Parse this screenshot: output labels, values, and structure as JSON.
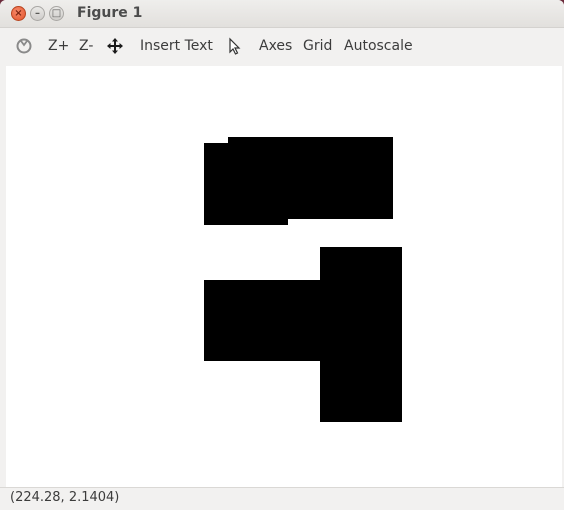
{
  "window": {
    "title": "Figure 1",
    "close_glyph": "×",
    "min_glyph": "–",
    "max_glyph": "□"
  },
  "toolbar": {
    "reset_icon": "reset-zoom-icon",
    "zoom_in_label": "Z+",
    "zoom_out_label": "Z-",
    "pan_icon": "move-arrows-icon",
    "insert_text_label": "Insert Text",
    "pointer_icon": "pointer-arrow-icon",
    "axes_label": "Axes",
    "grid_label": "Grid",
    "autoscale_label": "Autoscale"
  },
  "status": {
    "coordinates": "(224.28, 2.1404)"
  },
  "colors": {
    "shape_fill": "#000000",
    "canvas_bg": "#ffffff",
    "close_button": "#e2542c"
  }
}
